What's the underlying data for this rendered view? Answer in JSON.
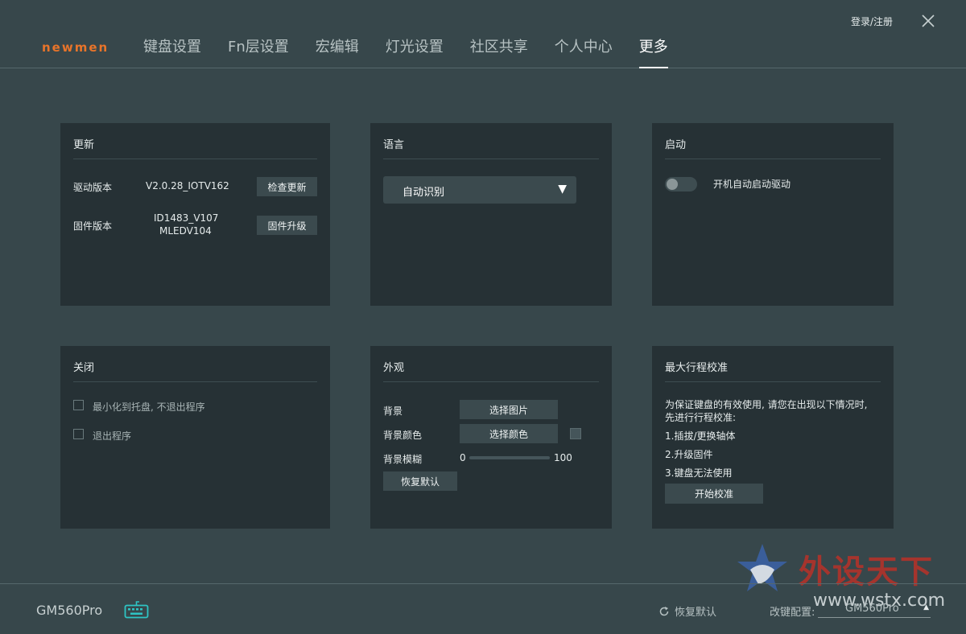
{
  "brand": {
    "logo": "newmen"
  },
  "nav": {
    "items": [
      {
        "label": "键盘设置"
      },
      {
        "label": "Fn层设置"
      },
      {
        "label": "宏编辑"
      },
      {
        "label": "灯光设置"
      },
      {
        "label": "社区共享"
      },
      {
        "label": "个人中心"
      },
      {
        "label": "更多",
        "active": true
      }
    ],
    "login": "登录/注册"
  },
  "update": {
    "title": "更新",
    "driver_label": "驱动版本",
    "driver_version": "V2.0.28_IOTV162",
    "check_button": "检查更新",
    "firmware_label": "固件版本",
    "firmware_version_line1": "ID1483_V107",
    "firmware_version_line2": "MLEDV104",
    "upgrade_button": "固件升级"
  },
  "language": {
    "title": "语言",
    "selected": "自动识别"
  },
  "startup": {
    "title": "启动",
    "toggle_label": "开机自动启动驱动",
    "enabled": false
  },
  "close_panel": {
    "title": "关闭",
    "options": [
      "最小化到托盘, 不退出程序",
      "退出程序"
    ]
  },
  "appearance": {
    "title": "外观",
    "bg_label": "背景",
    "choose_image": "选择图片",
    "bg_color_label": "背景颜色",
    "choose_color": "选择颜色",
    "blur_label": "背景模糊",
    "blur_min": "0",
    "blur_max": "100",
    "blur_value": 0,
    "restore_button": "恢复默认"
  },
  "calibration": {
    "title": "最大行程校准",
    "desc_line1": "为保证键盘的有效使用, 请您在出现以下情况时,",
    "desc_line2": "先进行行程校准:",
    "items": [
      "1.插拔/更换轴体",
      "2.升级固件",
      "3.键盘无法使用"
    ],
    "start_button": "开始校准"
  },
  "footer": {
    "model": "GM560Pro",
    "restore": "恢复默认",
    "config_label": "改键配置:",
    "config_value": "GM560Pro"
  },
  "watermark": {
    "text": "外设天下",
    "url": "www.wstx.com"
  },
  "colors": {
    "accent": "#e8742a",
    "card": "#263135",
    "bg": "#37474b",
    "teal": "#2ec4c4"
  }
}
